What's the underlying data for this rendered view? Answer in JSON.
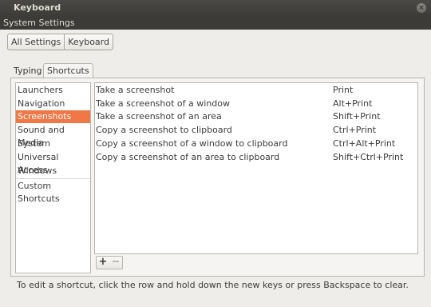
{
  "window": {
    "title": "Keyboard",
    "close_glyph": "×"
  },
  "menubar": {
    "app_menu": "System Settings"
  },
  "nav": {
    "all_settings": "All Settings",
    "current": "Keyboard"
  },
  "tabs": [
    {
      "label": "Typing",
      "selected": false
    },
    {
      "label": "Shortcuts",
      "selected": true
    }
  ],
  "categories": [
    {
      "label": "Launchers",
      "selected": false
    },
    {
      "label": "Navigation",
      "selected": false
    },
    {
      "label": "Screenshots",
      "selected": true
    },
    {
      "label": "Sound and Media",
      "selected": false
    },
    {
      "label": "System",
      "selected": false
    },
    {
      "label": "Universal Access",
      "selected": false
    },
    {
      "label": "Windows",
      "selected": false
    },
    {
      "label": "Custom Shortcuts",
      "selected": false
    }
  ],
  "shortcuts": [
    {
      "action": "Take a screenshot",
      "accel": "Print"
    },
    {
      "action": "Take a screenshot of a window",
      "accel": "Alt+Print"
    },
    {
      "action": "Take a screenshot of an area",
      "accel": "Shift+Print"
    },
    {
      "action": "Copy a screenshot to clipboard",
      "accel": "Ctrl+Print"
    },
    {
      "action": "Copy a screenshot of a window to clipboard",
      "accel": "Ctrl+Alt+Print"
    },
    {
      "action": "Copy a screenshot of an area to clipboard",
      "accel": "Shift+Ctrl+Print"
    }
  ],
  "toolbar": {
    "add_label": "+",
    "remove_label": "−"
  },
  "hint": "To edit a shortcut, click the row and hold down the new keys or press Backspace to clear.",
  "colors": {
    "selection": "#f07746",
    "titlebar": "#3c3b37"
  }
}
